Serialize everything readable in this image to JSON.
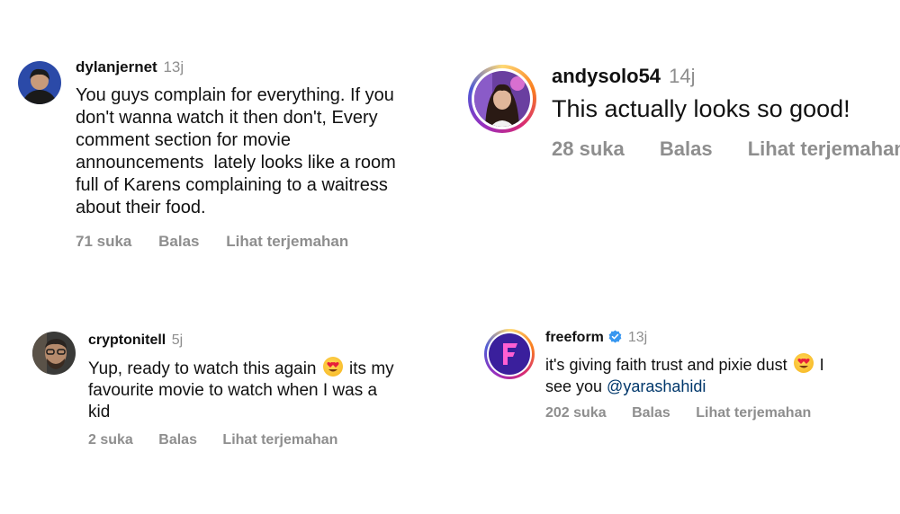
{
  "comments": [
    {
      "username": "dylanjernet",
      "time": "13j",
      "lines": [
        "You guys complain for everything. If you",
        "don't wanna watch it then don't, Every",
        "comment section for movie",
        "announcements  lately looks like a room",
        "full of Karens complaining to a waitress",
        "about their food."
      ],
      "likes": "71 suka",
      "reply": "Balas",
      "translate": "Lihat terjemahan"
    },
    {
      "username": "andysolo54",
      "time": "14j",
      "text": "This actually looks so good!",
      "likes": "28 suka",
      "reply": "Balas",
      "translate": "Lihat terjemahan"
    },
    {
      "username": "cryptonitell",
      "time": "5j",
      "line1_before": "Yup, ready to watch this again ",
      "line1_after": " its my",
      "line2": "favourite movie to watch when I was a",
      "line3": "kid",
      "likes": "2 suka",
      "reply": "Balas",
      "translate": "Lihat terjemahan"
    },
    {
      "username": "freeform",
      "time": "13j",
      "line1_before": "it's giving faith trust and pixie dust ",
      "line1_after": " I",
      "line2_before": "see you ",
      "mention": "@yarashahidi",
      "likes": "202 suka",
      "reply": "Balas",
      "translate": "Lihat terjemahan"
    }
  ],
  "colors": {
    "text": "#111111",
    "meta": "#8e8e8e",
    "mention": "#00376b",
    "verified": "#3897f0",
    "freeform_brand": "#3a1f9c"
  },
  "icons": [
    "avatar",
    "heart-eyes-emoji-icon",
    "verified-badge-icon",
    "freeform-logo-icon"
  ]
}
